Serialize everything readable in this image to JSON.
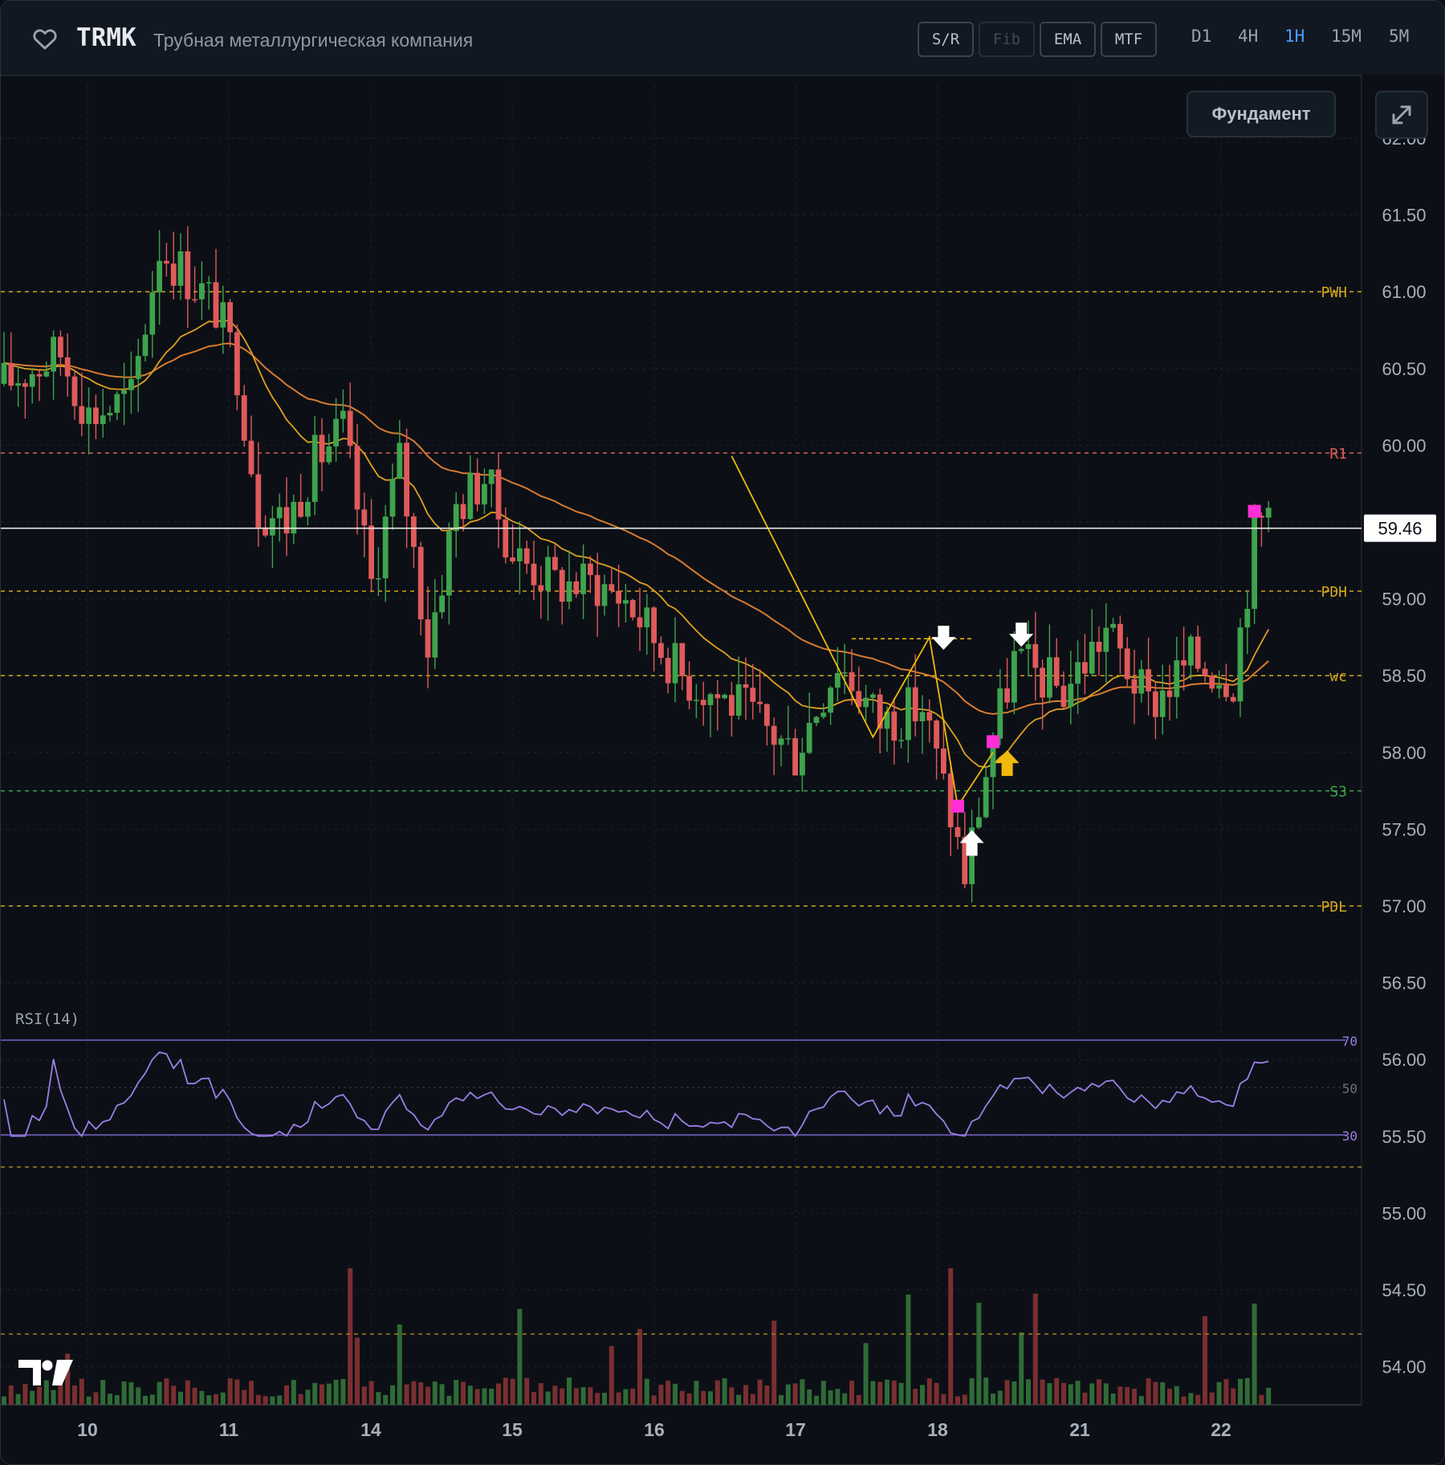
{
  "header": {
    "ticker": "TRMK",
    "company": "Трубная металлургическая компания",
    "tools": [
      "S/R",
      "Fib",
      "EMA",
      "MTF"
    ],
    "timeframes": [
      "D1",
      "4H",
      "1H",
      "15M",
      "5M"
    ],
    "active_timeframe": "1H",
    "fundament_label": "Фундамент"
  },
  "chart_data": {
    "type": "candlestick",
    "title": "",
    "x_labels": [
      "10",
      "11",
      "14",
      "15",
      "16",
      "17",
      "18",
      "21",
      "22"
    ],
    "y_ticks": [
      "62.00",
      "61.50",
      "61.00",
      "60.50",
      "60.00",
      "59.50",
      "59.00",
      "58.50",
      "58.00",
      "57.50",
      "57.00",
      "56.50",
      "56.00",
      "55.50",
      "55.00",
      "54.50",
      "54.00"
    ],
    "ylim": [
      53.8,
      62.1
    ],
    "current_price": "59.46",
    "levels": [
      {
        "label": "PWH",
        "price": 61.0,
        "color": "#d4a51c"
      },
      {
        "label": "R1",
        "price": 59.95,
        "color": "#e05a5a"
      },
      {
        "label": "PDH",
        "price": 59.05,
        "color": "#d4a51c"
      },
      {
        "label": "wc",
        "price": 58.5,
        "color": "#d4a51c"
      },
      {
        "label": "S3",
        "price": 57.75,
        "color": "#3fa34d"
      },
      {
        "label": "PDL",
        "price": 57.0,
        "color": "#d4a51c"
      }
    ],
    "key_path": [
      {
        "x": 103,
        "y": 59.93
      },
      {
        "x": 123,
        "y": 58.1
      },
      {
        "x": 131,
        "y": 58.75
      },
      {
        "x": 135,
        "y": 57.65
      },
      {
        "x": 140,
        "y": 58.0
      }
    ],
    "markers": [
      {
        "type": "arrow-down",
        "color": "#ffffff",
        "x": 133,
        "price": 58.72
      },
      {
        "type": "arrow-down",
        "color": "#ffffff",
        "x": 144,
        "price": 58.74
      },
      {
        "type": "arrow-up",
        "color": "#ffffff",
        "x": 137,
        "price": 57.4
      },
      {
        "type": "arrow-up",
        "color": "#f0b90b",
        "x": 142,
        "price": 57.92
      },
      {
        "type": "square",
        "color": "#ff2fd5",
        "x": 135,
        "price": 57.65
      },
      {
        "type": "square",
        "color": "#ff2fd5",
        "x": 140,
        "price": 58.07
      },
      {
        "type": "square",
        "color": "#ff2fd5",
        "x": 177,
        "price": 59.57
      }
    ],
    "rsi": {
      "label": "RSI(14)",
      "levels": [
        "70",
        "50",
        "30"
      ]
    },
    "colors": {
      "up": "#3fa34d",
      "down": "#e05a5a",
      "ema_fast": "#e0a020",
      "ema_slow": "#d87b2f",
      "rsi": "#9b7fe6"
    }
  }
}
